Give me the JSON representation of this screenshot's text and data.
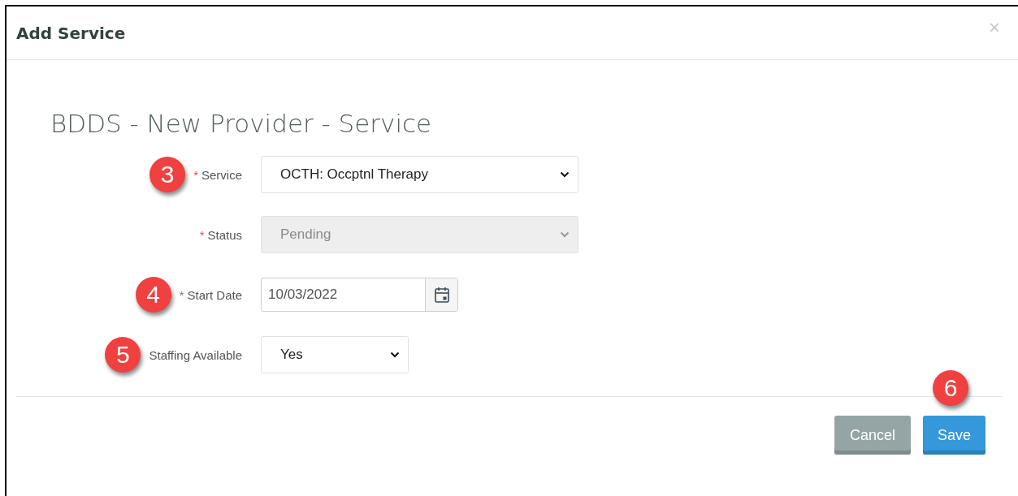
{
  "dialog": {
    "title": "Add Service",
    "close": "×"
  },
  "heading": "BDDS - New Provider - Service",
  "fields": [
    {
      "kind": "select",
      "label": "Service",
      "required_mark": "*",
      "value": "OCTH: Occptnl Therapy",
      "disabled": false,
      "callout": "3"
    },
    {
      "kind": "select",
      "label": "Status",
      "required_mark": "*",
      "value": "Pending",
      "disabled": true
    },
    {
      "kind": "date",
      "label": "Start Date",
      "required_mark": "*",
      "value": "10/03/2022",
      "disabled": false,
      "callout": "4"
    },
    {
      "kind": "choice",
      "label": "Staffing Available",
      "value": "Yes",
      "disabled": false,
      "callout": "5"
    }
  ],
  "buttons": [
    {
      "kind": "secondary",
      "label": "Cancel"
    },
    {
      "kind": "primary",
      "label": "Save",
      "callout": "6"
    }
  ]
}
